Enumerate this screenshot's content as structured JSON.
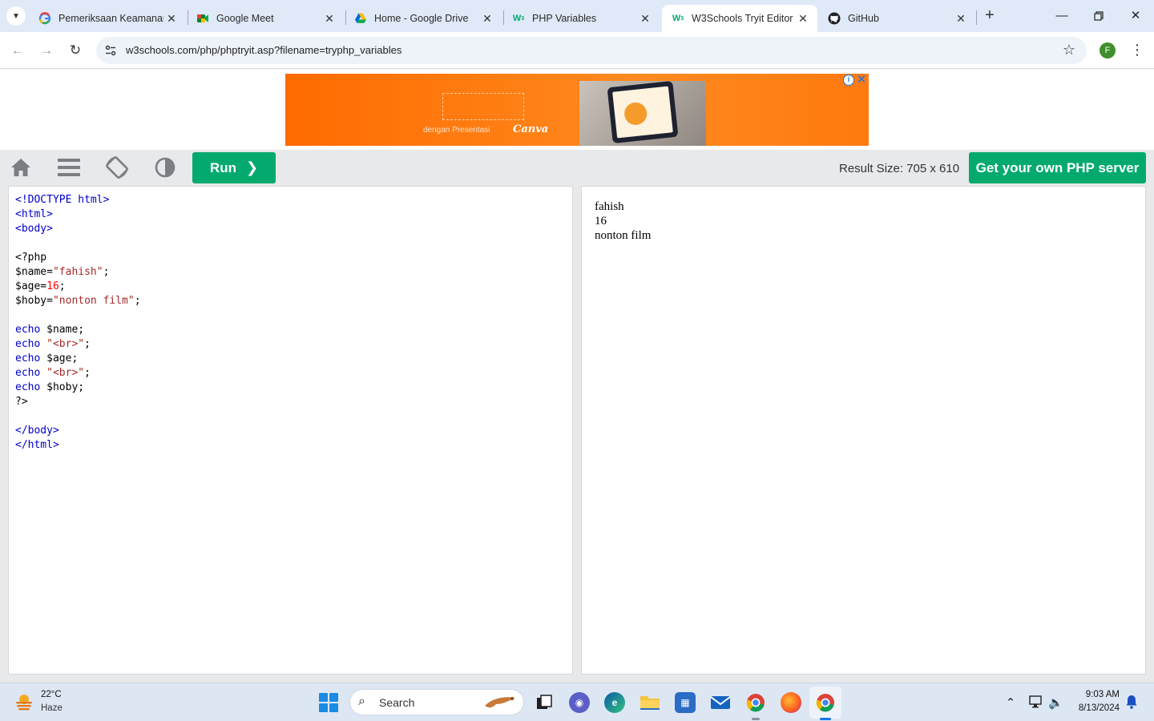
{
  "browser": {
    "tabs": [
      {
        "title": "Pemeriksaan Keamanan",
        "icon": "google-g-icon",
        "active": false
      },
      {
        "title": "Google Meet",
        "icon": "google-meet-icon",
        "active": false
      },
      {
        "title": "Home - Google Drive",
        "icon": "google-drive-icon",
        "active": false
      },
      {
        "title": "PHP Variables",
        "icon": "w3schools-icon",
        "active": false
      },
      {
        "title": "W3Schools Tryit Editor",
        "icon": "w3schools-icon",
        "active": true
      },
      {
        "title": "GitHub",
        "icon": "github-icon",
        "active": false
      }
    ],
    "url": "w3schools.com/php/phptryit.asp?filename=tryphp_variables",
    "profile_initial": "F"
  },
  "ad": {
    "tagline": "dengan Presentasi",
    "brand": "Canva"
  },
  "editor": {
    "run_label": "Run",
    "result_size": "Result Size: 705 x 610",
    "server_button": "Get your own PHP server",
    "code_lines": [
      [
        {
          "t": "tag",
          "v": "<!DOCTYPE html>"
        }
      ],
      [
        {
          "t": "tag",
          "v": "<html>"
        }
      ],
      [
        {
          "t": "tag",
          "v": "<body>"
        }
      ],
      [],
      [
        {
          "t": "plain",
          "v": "<?php"
        }
      ],
      [
        {
          "t": "plain",
          "v": "$name="
        },
        {
          "t": "str",
          "v": "\"fahish\""
        },
        {
          "t": "plain",
          "v": ";"
        }
      ],
      [
        {
          "t": "plain",
          "v": "$age="
        },
        {
          "t": "num",
          "v": "16"
        },
        {
          "t": "plain",
          "v": ";"
        }
      ],
      [
        {
          "t": "plain",
          "v": "$hoby="
        },
        {
          "t": "str",
          "v": "\"nonton film\""
        },
        {
          "t": "plain",
          "v": ";"
        }
      ],
      [],
      [
        {
          "t": "kw",
          "v": "echo"
        },
        {
          "t": "plain",
          "v": " $name;"
        }
      ],
      [
        {
          "t": "kw",
          "v": "echo"
        },
        {
          "t": "plain",
          "v": " "
        },
        {
          "t": "str",
          "v": "\"<br>\""
        },
        {
          "t": "plain",
          "v": ";"
        }
      ],
      [
        {
          "t": "kw",
          "v": "echo"
        },
        {
          "t": "plain",
          "v": " $age;"
        }
      ],
      [
        {
          "t": "kw",
          "v": "echo"
        },
        {
          "t": "plain",
          "v": " "
        },
        {
          "t": "str",
          "v": "\"<br>\""
        },
        {
          "t": "plain",
          "v": ";"
        }
      ],
      [
        {
          "t": "kw",
          "v": "echo"
        },
        {
          "t": "plain",
          "v": " $hoby;"
        }
      ],
      [
        {
          "t": "plain",
          "v": "?>"
        }
      ],
      [],
      [
        {
          "t": "tag",
          "v": "</body>"
        }
      ],
      [
        {
          "t": "tag",
          "v": "</html>"
        }
      ]
    ],
    "output_lines": [
      "fahish",
      "16",
      "nonton film"
    ]
  },
  "taskbar": {
    "weather_temp": "22°C",
    "weather_desc": "Haze",
    "search_placeholder": "Search",
    "time": "9:03 AM",
    "date": "8/13/2024"
  }
}
